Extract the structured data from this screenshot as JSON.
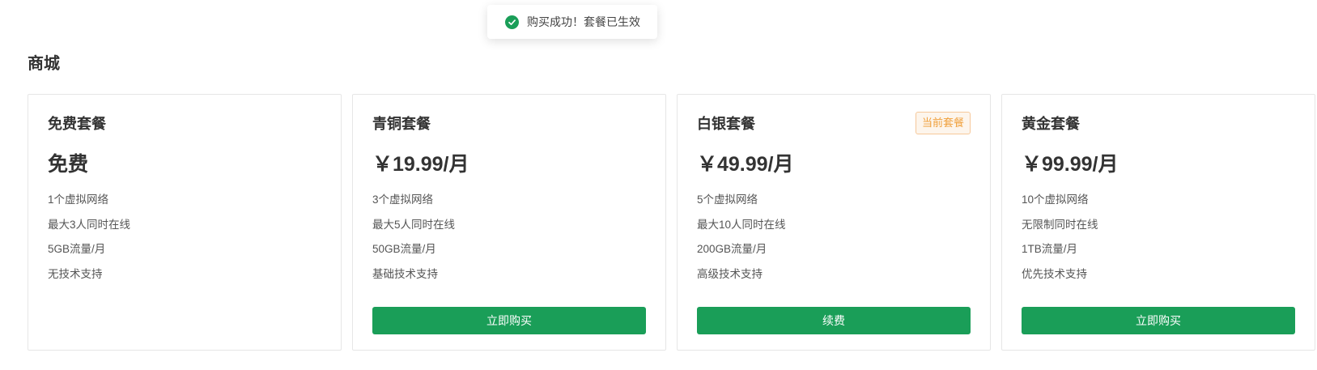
{
  "colors": {
    "success": "#1a9e58",
    "button": "#1a9e58",
    "badge_text": "#f0a03c"
  },
  "toast": {
    "icon": "check-circle-icon",
    "message": "购买成功！套餐已生效"
  },
  "page": {
    "title": "商城"
  },
  "plans": [
    {
      "name": "免费套餐",
      "price": "免费",
      "features": [
        "1个虚拟网络",
        "最大3人同时在线",
        "5GB流量/月",
        "无技术支持"
      ]
    },
    {
      "name": "青铜套餐",
      "price": "￥19.99/月",
      "features": [
        "3个虚拟网络",
        "最大5人同时在线",
        "50GB流量/月",
        "基础技术支持"
      ],
      "button_label": "立即购买"
    },
    {
      "name": "白银套餐",
      "price": "￥49.99/月",
      "badge": "当前套餐",
      "features": [
        "5个虚拟网络",
        "最大10人同时在线",
        "200GB流量/月",
        "高级技术支持"
      ],
      "button_label": "续费"
    },
    {
      "name": "黄金套餐",
      "price": "￥99.99/月",
      "features": [
        "10个虚拟网络",
        "无限制同时在线",
        "1TB流量/月",
        "优先技术支持"
      ],
      "button_label": "立即购买"
    }
  ]
}
